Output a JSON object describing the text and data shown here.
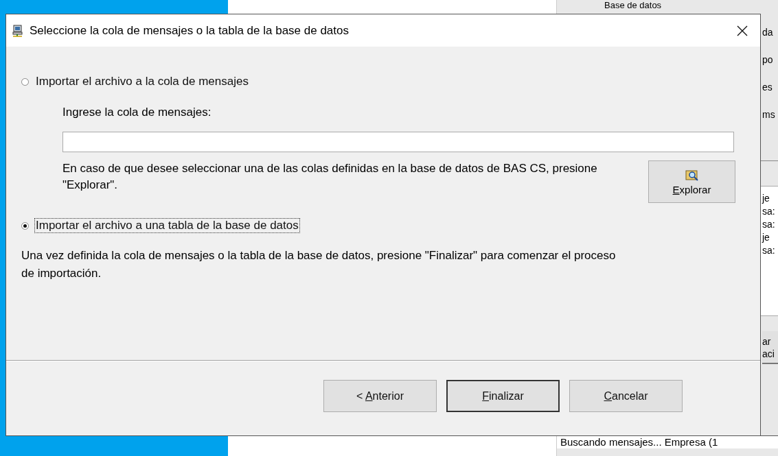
{
  "background": {
    "right_panel_lines": [
      {
        "text": "Base de datos",
        "kind": "header"
      },
      {
        "text": "da",
        "kind": "line"
      },
      {
        "text": "po",
        "kind": "line"
      },
      {
        "text": "es",
        "kind": "line"
      },
      {
        "text": "ms",
        "kind": "line"
      }
    ],
    "log_lines": [
      "je",
      "sa:",
      "sa:",
      "je",
      "sa:"
    ],
    "side_button_lines": [
      "ar",
      "aci"
    ],
    "status_text": "Buscando mensajes... Empresa (1"
  },
  "dialog": {
    "title": "Seleccione la cola de mensajes o la tabla de la base de datos",
    "options": [
      {
        "label": "Importar el archivo a la cola de mensajes",
        "selected": false
      },
      {
        "label": "Importar el archivo a una tabla de la base de datos",
        "selected": true
      }
    ],
    "queue_prompt": "Ingrese la cola de mensajes:",
    "explore_hint": "En caso de que desee seleccionar una de las colas definidas en la base de datos de BAS CS, presione \"Explorar\".",
    "explore_button": {
      "label": "Explorar"
    },
    "footer_note": "Una vez definida la cola de mensajes o la tabla de la base de datos, presione \"Finalizar\" para comenzar el proceso de importación.",
    "buttons": [
      {
        "label": "< Anterior",
        "default": false
      },
      {
        "label": "Finalizar",
        "default": true
      },
      {
        "label": "Cancelar",
        "default": false
      }
    ]
  }
}
